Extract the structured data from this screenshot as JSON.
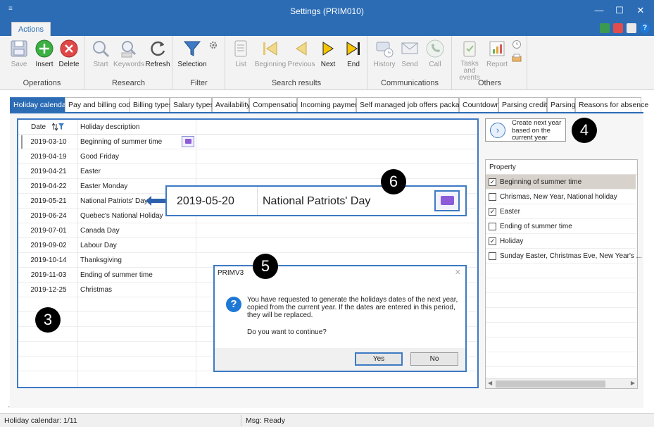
{
  "window": {
    "title": "Settings (PRIM010)",
    "menu_glyph": "≡",
    "minimize": "—",
    "maximize": "☐",
    "close": "✕"
  },
  "ribbon": {
    "tab": "Actions",
    "groups": {
      "operations": {
        "label": "Operations",
        "buttons": [
          "Save",
          "Insert",
          "Delete"
        ]
      },
      "research": {
        "label": "Research",
        "buttons": [
          "Start",
          "Keywords",
          "Refresh"
        ]
      },
      "filter": {
        "label": "Filter",
        "buttons": [
          "Selection"
        ]
      },
      "search_results": {
        "label": "Search results",
        "buttons": [
          "List",
          "Beginning",
          "Previous",
          "Next",
          "End"
        ]
      },
      "communications": {
        "label": "Communications",
        "buttons": [
          "History",
          "Send",
          "Call"
        ]
      },
      "others": {
        "label": "Others",
        "buttons": [
          "Tasks and events",
          "Report"
        ]
      }
    }
  },
  "tabs": [
    "Holiday calendar",
    "Pay and billing codes",
    "Billing types",
    "Salary types",
    "Availability",
    "Compensation",
    "Incoming payment",
    "Self managed job offers packages",
    "Countdown",
    "Parsing credits",
    "Parsing",
    "Reasons for absence"
  ],
  "grid": {
    "columns": {
      "date": "Date",
      "description": "Holiday description"
    },
    "rows": [
      {
        "date": "2019-03-10",
        "description": "Beginning of summer time"
      },
      {
        "date": "2019-04-19",
        "description": "Good Friday"
      },
      {
        "date": "2019-04-21",
        "description": "Easter"
      },
      {
        "date": "2019-04-22",
        "description": "Easter Monday"
      },
      {
        "date": "2019-05-21",
        "description": "National Patriots' Day"
      },
      {
        "date": "2019-06-24",
        "description": "Quebec's National Holiday"
      },
      {
        "date": "2019-07-01",
        "description": "Canada Day"
      },
      {
        "date": "2019-09-02",
        "description": "Labour Day"
      },
      {
        "date": "2019-10-14",
        "description": "Thanksgiving"
      },
      {
        "date": "2019-11-03",
        "description": "Ending of summer time"
      },
      {
        "date": "2019-12-25",
        "description": "Christmas"
      }
    ]
  },
  "zoom_callout": {
    "date": "2019-05-20",
    "description": "National Patriots' Day"
  },
  "next_year_button": {
    "label": "Create next year based on the current year"
  },
  "property_panel": {
    "header": "Property",
    "items": [
      {
        "label": "Beginning of summer time",
        "checked": true
      },
      {
        "label": "Chrismas, New Year, National holiday",
        "checked": false
      },
      {
        "label": "Easter",
        "checked": true
      },
      {
        "label": "Ending of summer time",
        "checked": false
      },
      {
        "label": "Holiday",
        "checked": true
      },
      {
        "label": "Sunday Easter, Christmas Eve, New Year's ...",
        "checked": false
      }
    ]
  },
  "dialog": {
    "title": "PRIMV3",
    "close": "✕",
    "message": "You have requested to generate the holidays dates of the next year, copied from the current year. If the dates are entered in this period, they will be replaced.",
    "question": "Do you want to continue?",
    "yes": "Yes",
    "no": "No"
  },
  "badges": [
    "3",
    "4",
    "5",
    "6"
  ],
  "status": {
    "left": "Holiday calendar: 1/11",
    "middle": "Msg: Ready"
  },
  "colors": {
    "accent": "#2b6cb5",
    "insert": "#3cb043",
    "delete": "#e04848",
    "memo": "#8c5bd8"
  }
}
